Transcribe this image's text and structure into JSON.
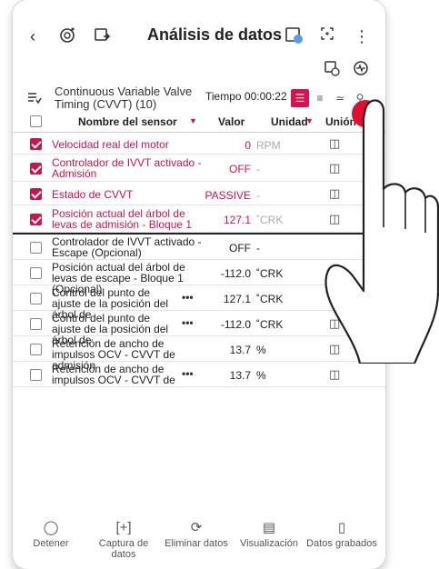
{
  "app": {
    "title": "Análisis de datos",
    "icons": {
      "back": "back-icon",
      "car_connect": "vehicle-connect-icon",
      "export": "export-icon",
      "record": "record-icon",
      "expand": "expand-icon",
      "menu": "more-vert-icon"
    }
  },
  "subbar": {
    "icons": [
      "snapshot-icon",
      "graph-icon"
    ]
  },
  "info": {
    "table_name": "Continuous Variable Valve Timing (CVVT) (10)",
    "time_label": "Tiempo 00:00:22"
  },
  "columns": {
    "name": "Nombre del sensor",
    "value": "Valor",
    "unit": "Unidad",
    "union": "Unión"
  },
  "rows": [
    {
      "name": "Velocidad real del motor",
      "value": "0",
      "unit": "RPM",
      "checked": true
    },
    {
      "name": "Controlador de IVVT activado - Admisión",
      "value": "OFF",
      "unit": "-",
      "checked": true
    },
    {
      "name": "Estado de CVVT",
      "value": "PASSIVE",
      "unit": "-",
      "checked": true
    },
    {
      "name": "Posición actual del árbol de levas de admisión - Bloque 1",
      "value": "127.1",
      "unit": "˚CRK",
      "checked": true
    },
    {
      "name": "Controlador de IVVT activado - Escape (Opcional)",
      "value": "OFF",
      "unit": "-",
      "checked": false
    },
    {
      "name": "Posición actual del árbol de levas de escape - Bloque 1 (Opcional)",
      "value": "-112.0",
      "unit": "˚CRK",
      "checked": false
    },
    {
      "name": "Control del punto de ajuste de la posición del árbol de",
      "value": "127.1",
      "unit": "˚CRK",
      "checked": false,
      "more": "•••"
    },
    {
      "name": "Control del punto de ajuste de la posición del árbol de",
      "value": "-112.0",
      "unit": "˚CRK",
      "checked": false,
      "more": "•••"
    },
    {
      "name": "Retención de ancho de impulsos OCV - CVVT de admisión",
      "value": "13.7",
      "unit": "%",
      "checked": false
    },
    {
      "name": "Retención de ancho de impulsos OCV - CVVT de",
      "value": "13.7",
      "unit": "%",
      "checked": false,
      "more": "•••"
    }
  ],
  "bottom_nav": [
    {
      "label": "Detener",
      "icon": "stop-icon"
    },
    {
      "label": "Captura de datos",
      "icon": "capture-icon"
    },
    {
      "label": "Eliminar datos",
      "icon": "refresh-icon"
    },
    {
      "label": "Visualización",
      "icon": "view-icon"
    },
    {
      "label": "Datos grabados",
      "icon": "folder-icon"
    }
  ],
  "colors": {
    "accent": "#c8164a",
    "tap_dot": "#e21030"
  }
}
